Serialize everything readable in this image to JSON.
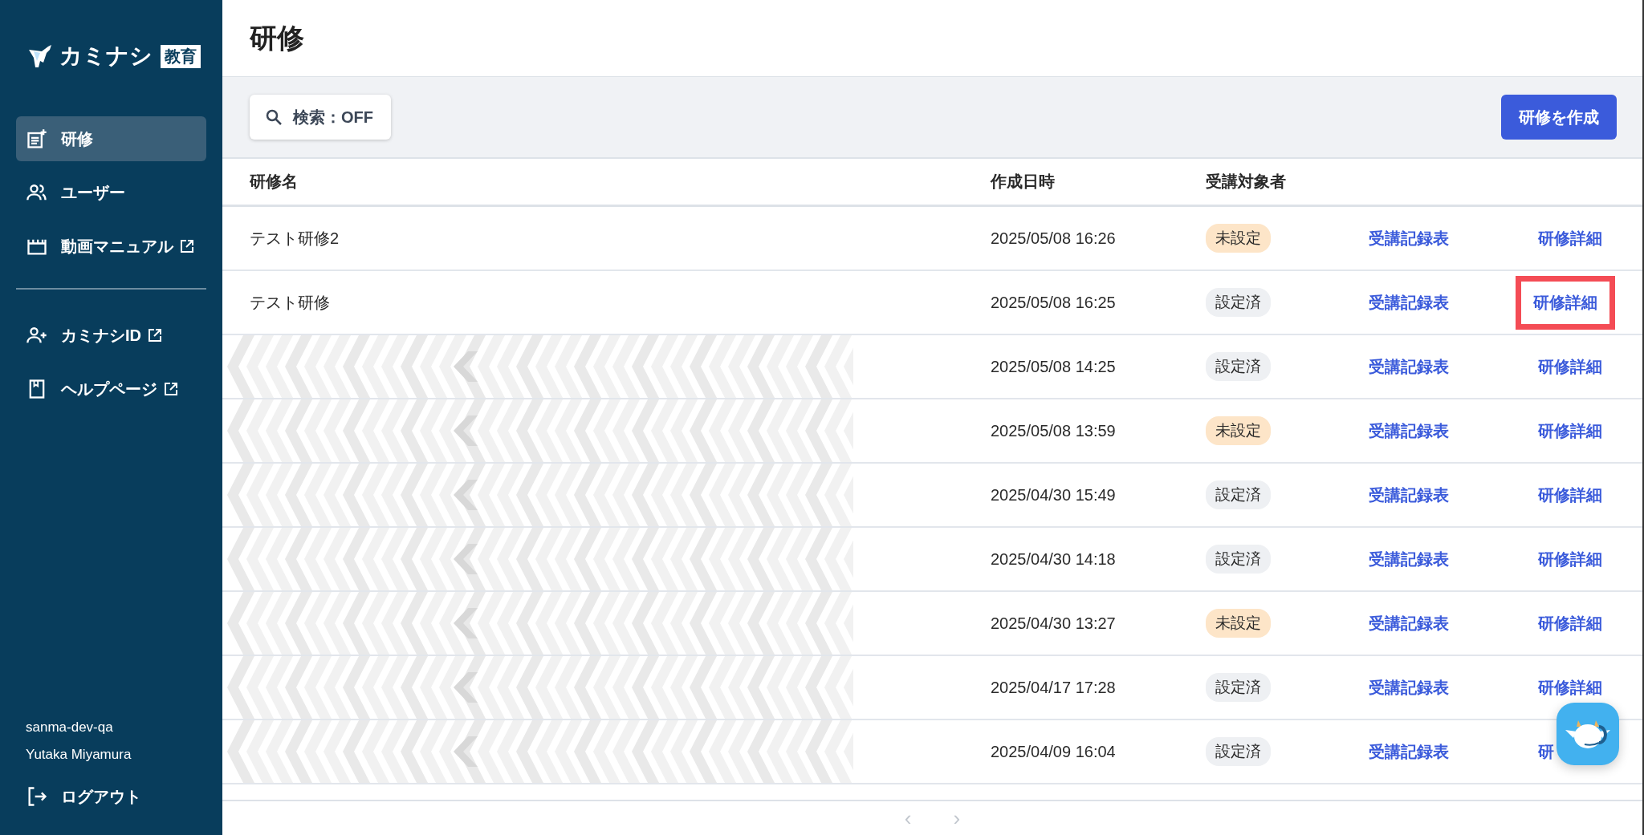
{
  "logo": {
    "name": "カミナシ",
    "badge": "教育"
  },
  "sidebar": {
    "items": [
      {
        "label": "研修",
        "external": false,
        "selected": true
      },
      {
        "label": "ユーザー",
        "external": false,
        "selected": false
      },
      {
        "label": "動画マニュアル",
        "external": true,
        "selected": false
      }
    ],
    "links": [
      {
        "label": "カミナシID",
        "external": true
      },
      {
        "label": "ヘルプページ",
        "external": true
      }
    ],
    "account": {
      "workspace": "sanma-dev-qa",
      "user": "Yutaka Miyamura"
    },
    "logout": "ログアウト"
  },
  "page": {
    "title": "研修"
  },
  "toolbar": {
    "search_button": "検索：OFF",
    "create_button": "研修を作成"
  },
  "table": {
    "columns": [
      "研修名",
      "作成日時",
      "受講対象者"
    ],
    "rows": [
      {
        "name": "テスト研修2",
        "redacted": false,
        "created": "2025/05/08 16:26",
        "status": {
          "label": "未設定",
          "kind": "unset"
        },
        "record_link": "受講記録表",
        "detail_link": "研修詳細",
        "highlighted": false
      },
      {
        "name": "テスト研修",
        "redacted": false,
        "created": "2025/05/08 16:25",
        "status": {
          "label": "設定済",
          "kind": "set"
        },
        "record_link": "受講記録表",
        "detail_link": "研修詳細",
        "highlighted": true
      },
      {
        "redacted": true,
        "created": "2025/05/08 14:25",
        "status": {
          "label": "設定済",
          "kind": "set"
        },
        "record_link": "受講記録表",
        "detail_link": "研修詳細",
        "highlighted": false
      },
      {
        "redacted": true,
        "created": "2025/05/08 13:59",
        "status": {
          "label": "未設定",
          "kind": "unset"
        },
        "record_link": "受講記録表",
        "detail_link": "研修詳細",
        "highlighted": false
      },
      {
        "redacted": true,
        "created": "2025/04/30 15:49",
        "status": {
          "label": "設定済",
          "kind": "set"
        },
        "record_link": "受講記録表",
        "detail_link": "研修詳細",
        "highlighted": false
      },
      {
        "redacted": true,
        "created": "2025/04/30 14:18",
        "status": {
          "label": "設定済",
          "kind": "set"
        },
        "record_link": "受講記録表",
        "detail_link": "研修詳細",
        "highlighted": false
      },
      {
        "redacted": true,
        "created": "2025/04/30 13:27",
        "status": {
          "label": "未設定",
          "kind": "unset"
        },
        "record_link": "受講記録表",
        "detail_link": "研修詳細",
        "highlighted": false
      },
      {
        "redacted": true,
        "created": "2025/04/17 17:28",
        "status": {
          "label": "設定済",
          "kind": "set"
        },
        "record_link": "受講記録表",
        "detail_link": "研修詳細",
        "highlighted": false
      },
      {
        "redacted": true,
        "created": "2025/04/09 16:04",
        "status": {
          "label": "設定済",
          "kind": "set"
        },
        "record_link": "受講記録表",
        "detail_link": "研",
        "highlighted": false
      }
    ]
  },
  "pagination": {
    "prev": {
      "label": "‹",
      "disabled": true
    },
    "next": {
      "label": "›",
      "disabled": true
    }
  }
}
